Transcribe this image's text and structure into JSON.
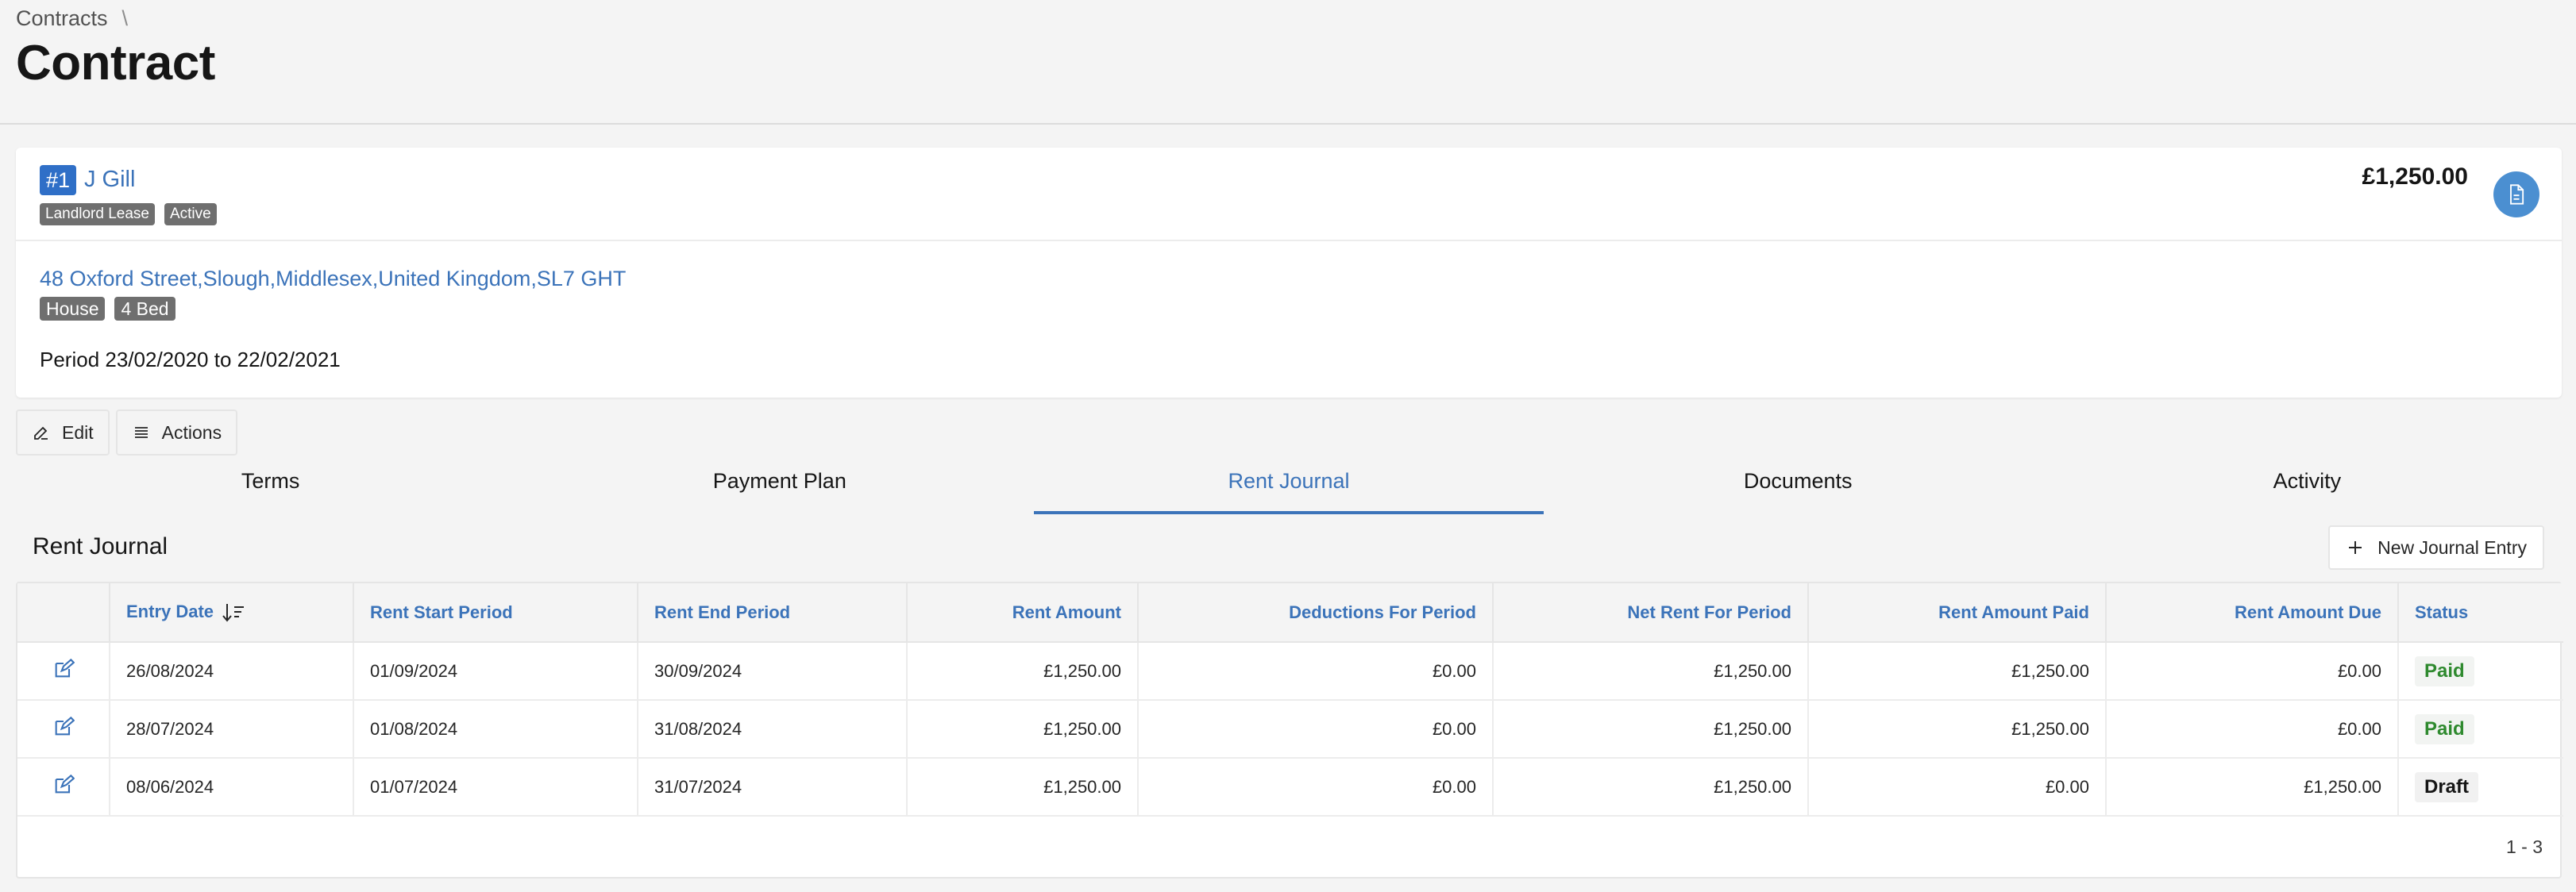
{
  "breadcrumb": {
    "parent": "Contracts",
    "separator": "\\"
  },
  "page": {
    "title": "Contract"
  },
  "contract": {
    "id": "#1",
    "name": "J Gill",
    "tags": [
      "Landlord Lease",
      "Active"
    ],
    "amount": "£1,250.00",
    "address": "48 Oxford Street,Slough,Middlesex,United Kingdom,SL7 GHT",
    "property_tags": [
      "House",
      "4 Bed"
    ],
    "period": "Period 23/02/2020 to 22/02/2021"
  },
  "actions": {
    "edit_label": "Edit",
    "actions_label": "Actions"
  },
  "tabs": [
    {
      "label": "Terms",
      "active": false
    },
    {
      "label": "Payment Plan",
      "active": false
    },
    {
      "label": "Rent Journal",
      "active": true
    },
    {
      "label": "Documents",
      "active": false
    },
    {
      "label": "Activity",
      "active": false
    }
  ],
  "journal": {
    "title": "Rent Journal",
    "new_entry_label": "New Journal Entry",
    "columns": [
      "Entry Date",
      "Rent Start Period",
      "Rent End Period",
      "Rent Amount",
      "Deductions For Period",
      "Net Rent For Period",
      "Rent Amount Paid",
      "Rent Amount Due",
      "Status"
    ],
    "rows": [
      {
        "entry_date": "26/08/2024",
        "start": "01/09/2024",
        "end": "30/09/2024",
        "amount": "£1,250.00",
        "deductions": "£0.00",
        "net": "£1,250.00",
        "paid": "£1,250.00",
        "due": "£0.00",
        "status": "Paid"
      },
      {
        "entry_date": "28/07/2024",
        "start": "01/08/2024",
        "end": "31/08/2024",
        "amount": "£1,250.00",
        "deductions": "£0.00",
        "net": "£1,250.00",
        "paid": "£1,250.00",
        "due": "£0.00",
        "status": "Paid"
      },
      {
        "entry_date": "08/06/2024",
        "start": "01/07/2024",
        "end": "31/07/2024",
        "amount": "£1,250.00",
        "deductions": "£0.00",
        "net": "£1,250.00",
        "paid": "£0.00",
        "due": "£1,250.00",
        "status": "Draft"
      }
    ],
    "pagination": "1 - 3"
  },
  "colors": {
    "accent": "#3b73b9",
    "id_badge": "#2f6fc7",
    "paid": "#2f8a2f",
    "doc_button": "#4b8fd1"
  }
}
